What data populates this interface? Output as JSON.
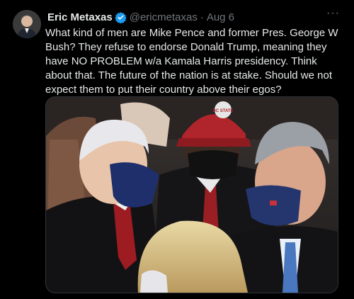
{
  "post": {
    "author_name": "Eric Metaxas",
    "author_handle": "@ericmetaxas",
    "separator": "·",
    "date": "Aug 6",
    "more_label": "···",
    "text": "What kind of men are Mike Pence and former Pres. George W Bush? They refuse to endorse Donald Trump, meaning they have NO PROBLEM w/a Kamala Harris presidency. Think about that. The future of the nation is at stake. Should we not expect them to put their country above their egos?",
    "media": {
      "cap_text": "DC STATE"
    }
  },
  "colors": {
    "background": "#000000",
    "text": "#e7e9ea",
    "secondary": "#71767b",
    "verified": "#1d9bf0"
  },
  "icons": {
    "verified": "verified-badge-icon",
    "more": "more-options-icon"
  }
}
